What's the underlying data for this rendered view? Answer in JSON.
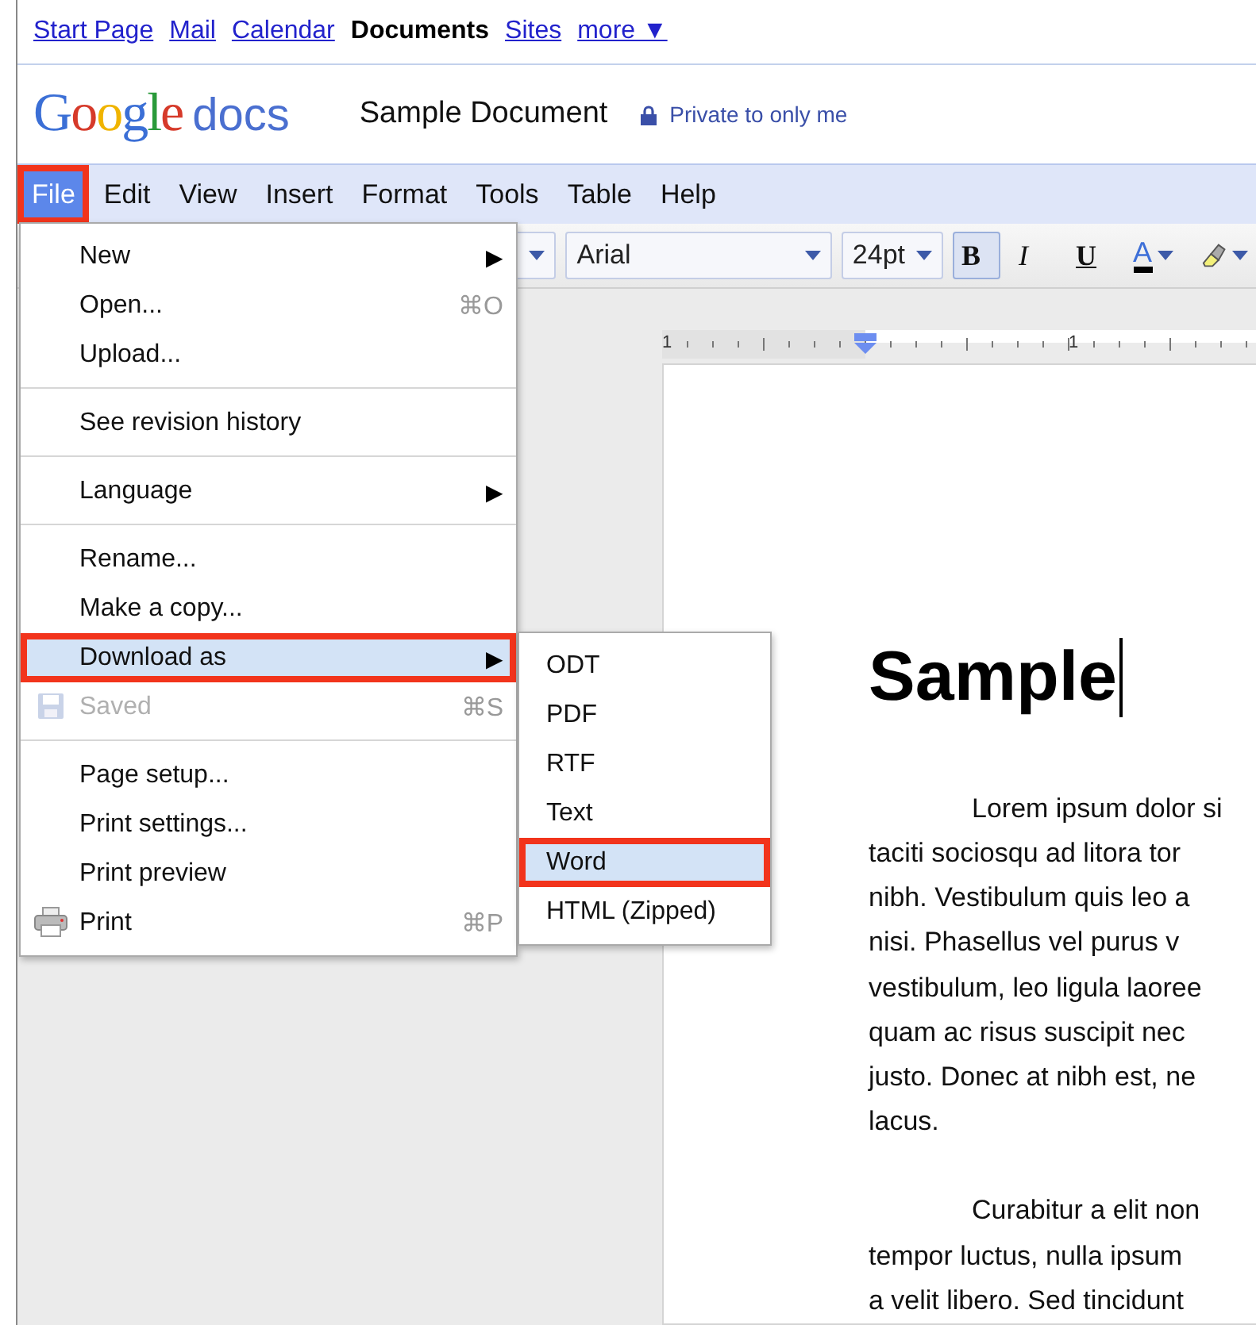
{
  "nav_links": [
    {
      "label": "Start Page",
      "current": false
    },
    {
      "label": "Mail",
      "current": false
    },
    {
      "label": "Calendar",
      "current": false
    },
    {
      "label": "Documents",
      "current": true
    },
    {
      "label": "Sites",
      "current": false
    },
    {
      "label": "more ▼",
      "current": false
    }
  ],
  "header": {
    "brand": "Google",
    "product": "docs",
    "document_title": "Sample Document",
    "sharing": "Private to only me"
  },
  "menu_bar": [
    {
      "label": "File",
      "selected": true,
      "annotated": true
    },
    {
      "label": "Edit",
      "selected": false,
      "annotated": false
    },
    {
      "label": "View",
      "selected": false,
      "annotated": false
    },
    {
      "label": "Insert",
      "selected": false,
      "annotated": false
    },
    {
      "label": "Format",
      "selected": false,
      "annotated": false
    },
    {
      "label": "Tools",
      "selected": false,
      "annotated": false
    },
    {
      "label": "Table",
      "selected": false,
      "annotated": false
    },
    {
      "label": "Help",
      "selected": false,
      "annotated": false
    }
  ],
  "toolbar": {
    "font": "Arial",
    "size": "24pt",
    "buttons": [
      {
        "kind": "bold",
        "label": "B",
        "selected": true
      },
      {
        "kind": "italic",
        "label": "I",
        "selected": false
      },
      {
        "kind": "underline",
        "label": "U",
        "selected": false
      },
      {
        "kind": "text_color",
        "label": "A",
        "color": "#000000"
      },
      {
        "kind": "highlight"
      }
    ]
  },
  "ruler": {
    "labels": [
      "1",
      "1"
    ]
  },
  "document": {
    "heading": "Sample",
    "paragraphs": [
      [
        "Lorem ipsum dolor si",
        "taciti sociosqu ad litora tor",
        "nibh. Vestibulum quis leo a",
        "nisi. Phasellus vel purus v",
        "vestibulum, leo ligula laoree",
        "quam ac risus suscipit nec",
        "justo. Donec at nibh est, ne",
        "lacus."
      ],
      [
        "Curabitur a elit non",
        "tempor luctus, nulla ipsum",
        "a velit libero. Sed tincidunt"
      ]
    ]
  },
  "file_menu": [
    {
      "kind": "item",
      "label": "New",
      "arrow": "▶",
      "selected": false,
      "disabled": false,
      "annotated": false
    },
    {
      "kind": "item",
      "label": "Open...",
      "shortcut": "⌘O",
      "selected": false,
      "disabled": false,
      "annotated": false
    },
    {
      "kind": "item",
      "label": "Upload...",
      "selected": false,
      "disabled": false,
      "annotated": false
    },
    {
      "kind": "separator"
    },
    {
      "kind": "item",
      "label": "See revision history",
      "selected": false,
      "disabled": false,
      "annotated": false
    },
    {
      "kind": "separator"
    },
    {
      "kind": "item",
      "label": "Language",
      "arrow": "▶",
      "selected": false,
      "disabled": false,
      "annotated": false
    },
    {
      "kind": "separator"
    },
    {
      "kind": "item",
      "label": "Rename...",
      "selected": false,
      "disabled": false,
      "annotated": false
    },
    {
      "kind": "item",
      "label": "Make a copy...",
      "selected": false,
      "disabled": false,
      "annotated": false
    },
    {
      "kind": "item",
      "label": "Download as",
      "arrow": "▶",
      "selected": true,
      "disabled": false,
      "annotated": true
    },
    {
      "kind": "save_item",
      "label": "Saved",
      "shortcut": "⌘S",
      "selected": false,
      "disabled": true,
      "annotated": false
    },
    {
      "kind": "separator"
    },
    {
      "kind": "item",
      "label": "Page setup...",
      "selected": false,
      "disabled": false,
      "annotated": false
    },
    {
      "kind": "item",
      "label": "Print settings...",
      "selected": false,
      "disabled": false,
      "annotated": false
    },
    {
      "kind": "item",
      "label": "Print preview",
      "selected": false,
      "disabled": false,
      "annotated": false
    },
    {
      "kind": "print_item",
      "label": "Print",
      "shortcut": "⌘P",
      "selected": false,
      "disabled": false,
      "annotated": false
    }
  ],
  "download_submenu": [
    {
      "label": "ODT",
      "selected": false,
      "annotated": false
    },
    {
      "label": "PDF",
      "selected": false,
      "annotated": false
    },
    {
      "label": "RTF",
      "selected": false,
      "annotated": false
    },
    {
      "label": "Text",
      "selected": false,
      "annotated": false
    },
    {
      "label": "Word",
      "selected": true,
      "annotated": true
    },
    {
      "label": "HTML (Zipped)",
      "selected": false,
      "annotated": false
    }
  ]
}
